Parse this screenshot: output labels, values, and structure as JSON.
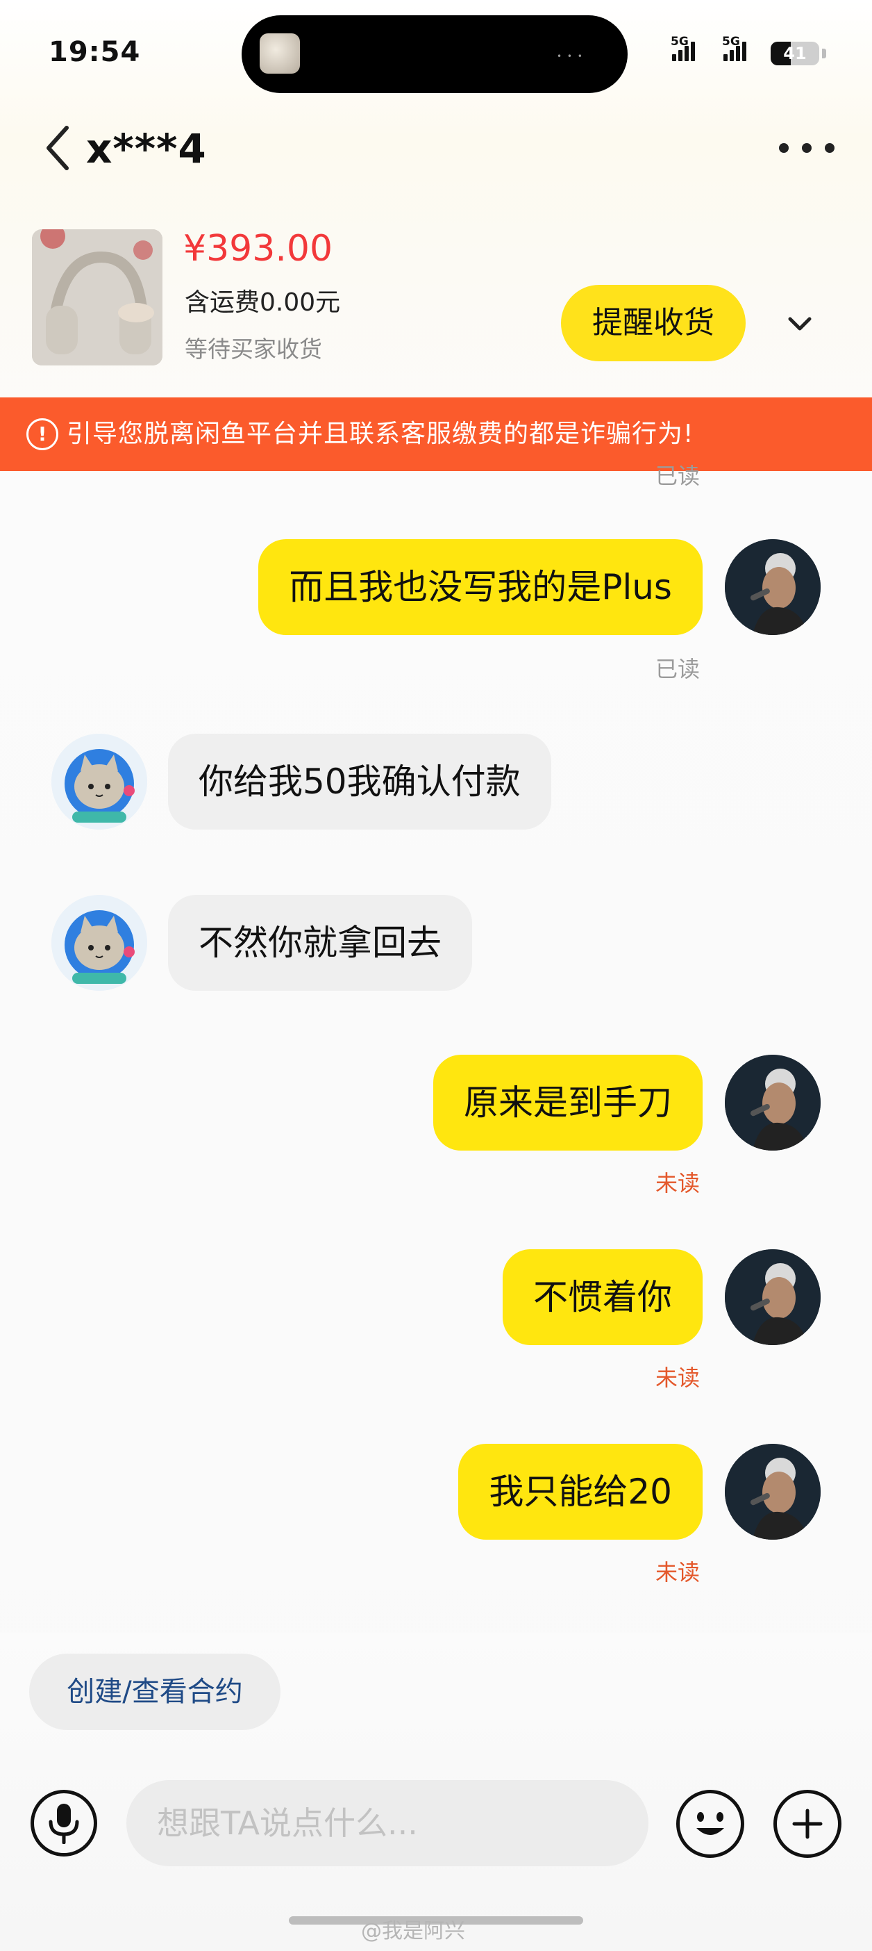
{
  "status_bar": {
    "time": "19:54",
    "network_1": "5G",
    "network_2": "5G",
    "battery": "41",
    "battery_level": 0.41
  },
  "header": {
    "title": "x***4"
  },
  "product": {
    "price": "¥393.00",
    "shipping": "含运费0.00元",
    "status": "等待买家收货",
    "remind_label": "提醒收货"
  },
  "warning": {
    "text": "引导您脱离闲鱼平台并且联系客服缴费的都是诈骗行为!"
  },
  "messages": [
    {
      "label": "已读",
      "side": "me-top"
    },
    {
      "text": "而且我也没写我的是Plus",
      "side": "me",
      "status": "已读"
    },
    {
      "text": "你给我50我确认付款",
      "side": "them"
    },
    {
      "text": "不然你就拿回去",
      "side": "them"
    },
    {
      "text": "原来是到手刀",
      "side": "me",
      "status": "未读"
    },
    {
      "text": "不惯着你",
      "side": "me",
      "status": "未读"
    },
    {
      "text": "我只能给20",
      "side": "me",
      "status": "未读"
    }
  ],
  "bottom": {
    "contract_label": "创建/查看合约",
    "input_placeholder": "想跟TA说点什么..."
  },
  "watermark": "@我是阿兴",
  "colors": {
    "accent_yellow": "#ffe60f",
    "price_red": "#f2383a",
    "warning_orange": "#fb5b2c",
    "unread_orange": "#e4582b"
  }
}
